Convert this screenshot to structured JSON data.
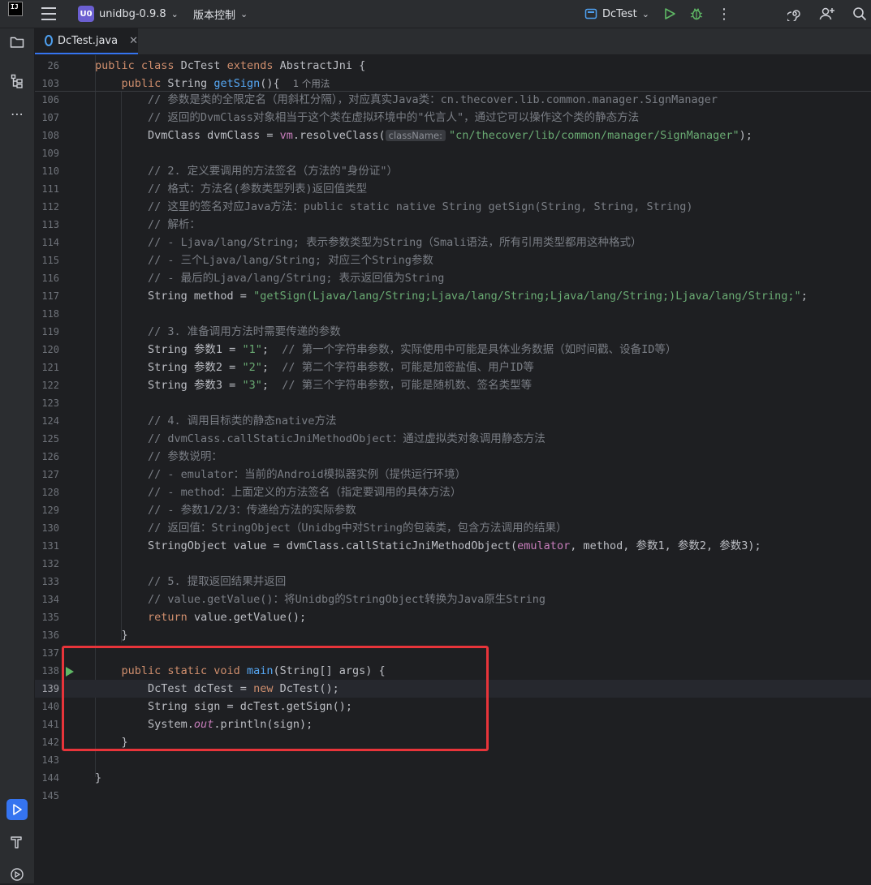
{
  "titlebar": {
    "logo_text": "IJ",
    "project_badge": "U0",
    "project_name": "unidbg-0.9.8",
    "vcs_label": "版本控制",
    "run_config": "DcTest"
  },
  "tab": {
    "filename": "DcTest.java"
  },
  "editor": {
    "sticky": [
      {
        "ln": "26",
        "tokens": [
          [
            "kw",
            "public class "
          ],
          [
            "cls",
            "DcTest "
          ],
          [
            "kw",
            "extends "
          ],
          [
            "cls",
            "AbstractJni {"
          ]
        ]
      },
      {
        "ln": "103",
        "tokens": [
          [
            "cls",
            "    "
          ],
          [
            "kw",
            "public "
          ],
          [
            "cls",
            "String "
          ],
          [
            "fn",
            "getSign"
          ],
          [
            "cls",
            "(){  "
          ],
          [
            "hint",
            "1 个用法"
          ]
        ]
      }
    ],
    "lines": [
      {
        "ln": "106",
        "tokens": [
          [
            "cm",
            "        // 参数是类的全限定名（用斜杠分隔），对应真实Java类：cn.thecover.lib.common.manager.SignManager"
          ]
        ]
      },
      {
        "ln": "107",
        "tokens": [
          [
            "cm",
            "        // 返回的DvmClass对象相当于这个类在虚拟环境中的\"代言人\"，通过它可以操作这个类的静态方法"
          ]
        ]
      },
      {
        "ln": "108",
        "tokens": [
          [
            "cls",
            "        DvmClass dvmClass = "
          ],
          [
            "field",
            "vm"
          ],
          [
            "cls",
            ".resolveClass("
          ],
          [
            "param",
            "className:"
          ],
          [
            "str",
            "\"cn/thecover/lib/common/manager/SignManager\""
          ],
          [
            "cls",
            ");"
          ]
        ]
      },
      {
        "ln": "109",
        "tokens": []
      },
      {
        "ln": "110",
        "tokens": [
          [
            "cm",
            "        // 2. 定义要调用的方法签名（方法的\"身份证\"）"
          ]
        ]
      },
      {
        "ln": "111",
        "tokens": [
          [
            "cm",
            "        // 格式：方法名(参数类型列表)返回值类型"
          ]
        ]
      },
      {
        "ln": "112",
        "tokens": [
          [
            "cm",
            "        // 这里的签名对应Java方法：public static native String getSign(String, String, String)"
          ]
        ]
      },
      {
        "ln": "113",
        "tokens": [
          [
            "cm",
            "        // 解析："
          ]
        ]
      },
      {
        "ln": "114",
        "tokens": [
          [
            "cm",
            "        // - Ljava/lang/String; 表示参数类型为String（Smali语法，所有引用类型都用这种格式）"
          ]
        ]
      },
      {
        "ln": "115",
        "tokens": [
          [
            "cm",
            "        // - 三个Ljava/lang/String; 对应三个String参数"
          ]
        ]
      },
      {
        "ln": "116",
        "tokens": [
          [
            "cm",
            "        // - 最后的Ljava/lang/String; 表示返回值为String"
          ]
        ]
      },
      {
        "ln": "117",
        "tokens": [
          [
            "cls",
            "        String method = "
          ],
          [
            "str",
            "\"getSign(Ljava/lang/String;Ljava/lang/String;Ljava/lang/String;)Ljava/lang/String;\""
          ],
          [
            "cls",
            ";"
          ]
        ]
      },
      {
        "ln": "118",
        "tokens": []
      },
      {
        "ln": "119",
        "tokens": [
          [
            "cm",
            "        // 3. 准备调用方法时需要传递的参数"
          ]
        ]
      },
      {
        "ln": "120",
        "tokens": [
          [
            "cls",
            "        String 参数1 = "
          ],
          [
            "str",
            "\"1\""
          ],
          [
            "cls",
            ";  "
          ],
          [
            "cm",
            "// 第一个字符串参数，实际使用中可能是具体业务数据（如时间戳、设备ID等）"
          ]
        ]
      },
      {
        "ln": "121",
        "tokens": [
          [
            "cls",
            "        String 参数2 = "
          ],
          [
            "str",
            "\"2\""
          ],
          [
            "cls",
            ";  "
          ],
          [
            "cm",
            "// 第二个字符串参数，可能是加密盐值、用户ID等"
          ]
        ]
      },
      {
        "ln": "122",
        "tokens": [
          [
            "cls",
            "        String 参数3 = "
          ],
          [
            "str",
            "\"3\""
          ],
          [
            "cls",
            ";  "
          ],
          [
            "cm",
            "// 第三个字符串参数，可能是随机数、签名类型等"
          ]
        ]
      },
      {
        "ln": "123",
        "tokens": []
      },
      {
        "ln": "124",
        "tokens": [
          [
            "cm",
            "        // 4. 调用目标类的静态native方法"
          ]
        ]
      },
      {
        "ln": "125",
        "tokens": [
          [
            "cm",
            "        // dvmClass.callStaticJniMethodObject：通过虚拟类对象调用静态方法"
          ]
        ]
      },
      {
        "ln": "126",
        "tokens": [
          [
            "cm",
            "        // 参数说明："
          ]
        ]
      },
      {
        "ln": "127",
        "tokens": [
          [
            "cm",
            "        // - emulator：当前的Android模拟器实例（提供运行环境）"
          ]
        ]
      },
      {
        "ln": "128",
        "tokens": [
          [
            "cm",
            "        // - method：上面定义的方法签名（指定要调用的具体方法）"
          ]
        ]
      },
      {
        "ln": "129",
        "tokens": [
          [
            "cm",
            "        // - 参数1/2/3：传递给方法的实际参数"
          ]
        ]
      },
      {
        "ln": "130",
        "tokens": [
          [
            "cm",
            "        // 返回值：StringObject（Unidbg中对String的包装类，包含方法调用的结果）"
          ]
        ]
      },
      {
        "ln": "131",
        "tokens": [
          [
            "cls",
            "        StringObject value = dvmClass.callStaticJniMethodObject("
          ],
          [
            "field",
            "emulator"
          ],
          [
            "cls",
            ", method, 参数1, 参数2, 参数3);"
          ]
        ]
      },
      {
        "ln": "132",
        "tokens": []
      },
      {
        "ln": "133",
        "tokens": [
          [
            "cm",
            "        // 5. 提取返回结果并返回"
          ]
        ]
      },
      {
        "ln": "134",
        "tokens": [
          [
            "cm",
            "        // value.getValue()：将Unidbg的StringObject转换为Java原生String"
          ]
        ]
      },
      {
        "ln": "135",
        "tokens": [
          [
            "cls",
            "        "
          ],
          [
            "kw",
            "return "
          ],
          [
            "cls",
            "value.getValue();"
          ]
        ]
      },
      {
        "ln": "136",
        "tokens": [
          [
            "cls",
            "    }"
          ]
        ]
      },
      {
        "ln": "137",
        "tokens": []
      },
      {
        "ln": "138",
        "tokens": [
          [
            "cls",
            "    "
          ],
          [
            "kw",
            "public static void "
          ],
          [
            "fn",
            "main"
          ],
          [
            "cls",
            "(String[] args) {"
          ]
        ],
        "run": true
      },
      {
        "ln": "139",
        "tokens": [
          [
            "cls",
            "        DcTest dcTest = "
          ],
          [
            "kw",
            "new "
          ],
          [
            "cls",
            "DcTest();"
          ]
        ],
        "current": true
      },
      {
        "ln": "140",
        "tokens": [
          [
            "cls",
            "        String sign = dcTest.getSign();"
          ]
        ]
      },
      {
        "ln": "141",
        "tokens": [
          [
            "cls",
            "        System."
          ],
          [
            "fieldi",
            "out"
          ],
          [
            "cls",
            ".println(sign);"
          ]
        ]
      },
      {
        "ln": "142",
        "tokens": [
          [
            "cls",
            "    }"
          ]
        ]
      },
      {
        "ln": "143",
        "tokens": []
      },
      {
        "ln": "144",
        "tokens": [
          [
            "cls",
            "}"
          ]
        ]
      },
      {
        "ln": "145",
        "tokens": []
      }
    ]
  },
  "colors": {
    "accent": "#3574f0",
    "highlight_box": "#e8343a",
    "run_marker": "#5fb865"
  }
}
